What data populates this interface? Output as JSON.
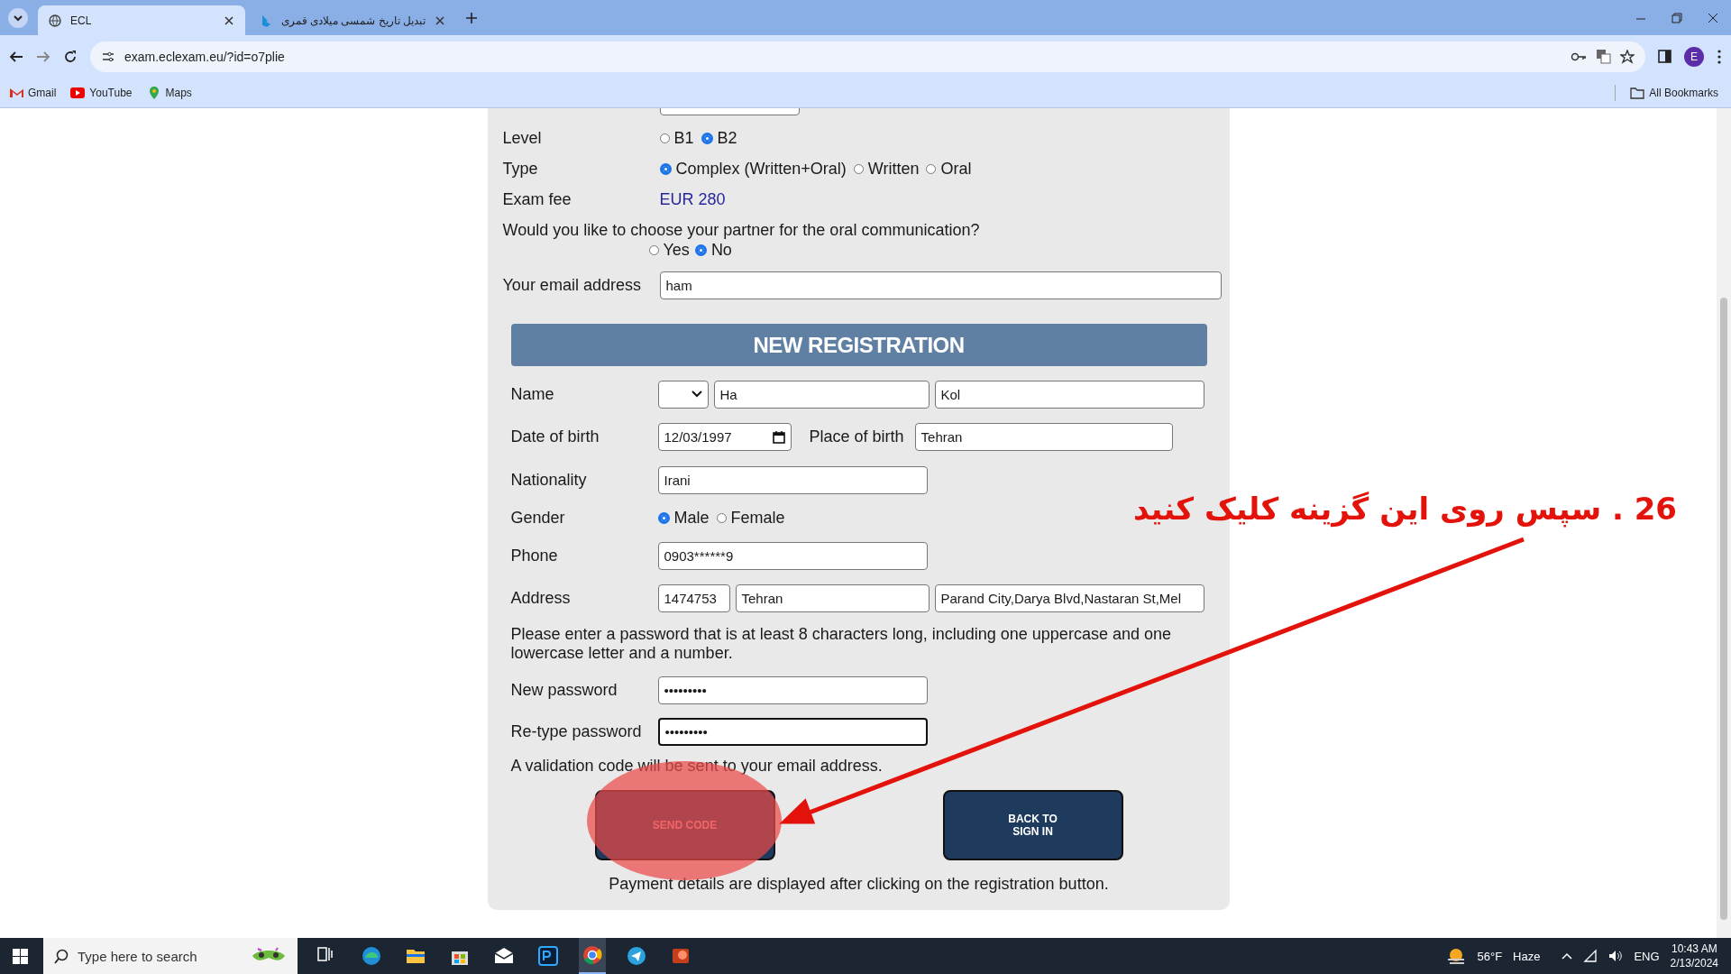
{
  "browser": {
    "tabs": [
      {
        "title": "ECL",
        "selected": true
      },
      {
        "title": "تبدیل تاریخ شمسی میلادی قمری",
        "selected": false
      }
    ],
    "address": "exam.eclexam.eu/?id=o7plie",
    "profile_initial": "E",
    "bookmarks": [
      "Gmail",
      "YouTube",
      "Maps"
    ],
    "all_bookmarks": "All Bookmarks"
  },
  "exam_form": {
    "level": {
      "label": "Level",
      "options": [
        {
          "label": "B1",
          "selected": false
        },
        {
          "label": "B2",
          "selected": true
        }
      ]
    },
    "type": {
      "label": "Type",
      "options": [
        {
          "label": "Complex (Written+Oral)",
          "selected": true
        },
        {
          "label": "Written",
          "selected": false
        },
        {
          "label": "Oral",
          "selected": false
        }
      ]
    },
    "exam_fee": {
      "label": "Exam fee",
      "value": "EUR 280"
    },
    "partner": {
      "question": "Would you like to choose your partner for the oral communication?",
      "options": [
        {
          "label": "Yes",
          "selected": false
        },
        {
          "label": "No",
          "selected": true
        }
      ]
    },
    "email": {
      "label": "Your email address",
      "value": "ham"
    }
  },
  "registration": {
    "heading": "NEW REGISTRATION",
    "rows": [
      {
        "kind": "fields",
        "label": "Name",
        "fields": [
          {
            "kind": "select"
          },
          {
            "kind": "text",
            "value": "Ha"
          },
          {
            "kind": "text",
            "value": "Kol"
          }
        ]
      },
      {
        "kind": "fields",
        "label": "Date of birth",
        "fields": [
          {
            "kind": "date",
            "value": "12/03/1997"
          },
          {
            "kind": "label",
            "text": "Place of birth"
          },
          {
            "kind": "text",
            "value": "Tehran"
          }
        ]
      },
      {
        "kind": "fields",
        "label": "Nationality",
        "fields": [
          {
            "kind": "text",
            "value": "Irani"
          }
        ]
      },
      {
        "kind": "radios",
        "label": "Gender",
        "options": [
          {
            "label": "Male",
            "selected": true
          },
          {
            "label": "Female",
            "selected": false
          }
        ]
      },
      {
        "kind": "fields",
        "label": "Phone",
        "fields": [
          {
            "kind": "text",
            "value": "0903******9"
          }
        ]
      },
      {
        "kind": "fields",
        "label": "Address",
        "fields": [
          {
            "kind": "text",
            "value": "1474753"
          },
          {
            "kind": "text",
            "value": "Tehran"
          },
          {
            "kind": "text",
            "value": "Parand City,Darya Blvd,Nastaran St,Mel"
          }
        ]
      },
      {
        "kind": "note",
        "text": "Please enter a password that is at least 8 characters long, including one uppercase and one lowercase letter and a number."
      },
      {
        "kind": "fields",
        "label": "New password",
        "fields": [
          {
            "kind": "password",
            "value": "•••••••••",
            "focused": false
          }
        ]
      },
      {
        "kind": "fields",
        "label": "Re-type password",
        "fields": [
          {
            "kind": "password",
            "value": "•••••••••",
            "focused": true
          }
        ]
      },
      {
        "kind": "note",
        "text": "A validation code will be sent to your email address."
      }
    ],
    "buttons": [
      {
        "label": "SEND CODE",
        "highlighted": true
      },
      {
        "label": "BACK TO SIGN IN",
        "highlighted": false
      }
    ],
    "footer": "Payment details are displayed after clicking on the registration button."
  },
  "annotation": {
    "text": "26 . سپس روی این گزینه کلیک کنید"
  },
  "taskbar": {
    "search_placeholder": "Type here to search",
    "weather": {
      "temperature": "56°F",
      "condition": "Haze"
    },
    "language": "ENG",
    "time": "10:43 AM",
    "date": "2/13/2024"
  }
}
